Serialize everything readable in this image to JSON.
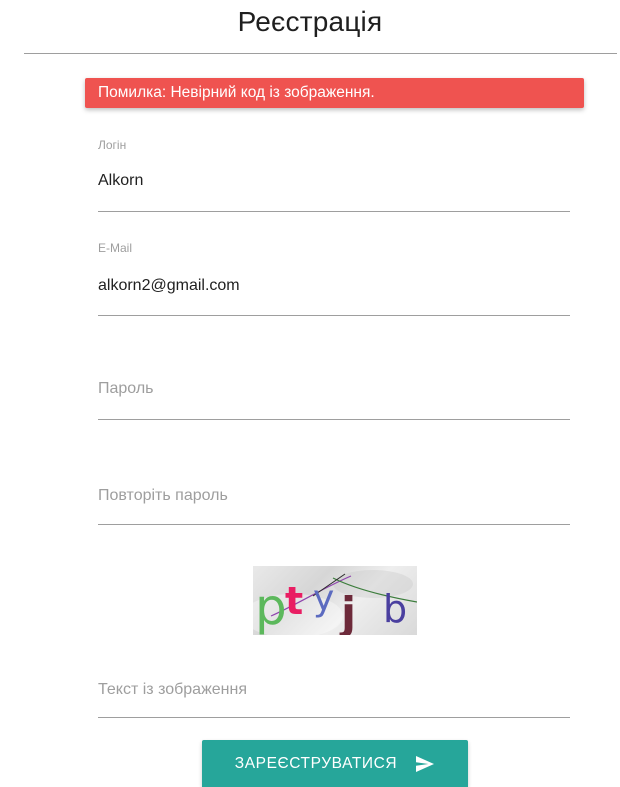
{
  "page": {
    "title": "Реєстрація"
  },
  "alert": {
    "text": "Помилка: Невірний код із зображення.",
    "color": "#ef5350"
  },
  "form": {
    "login": {
      "label": "Логін",
      "value": "Alkorn"
    },
    "email": {
      "label": "E-Mail",
      "value": "alkorn2@gmail.com"
    },
    "password": {
      "placeholder": "Пароль"
    },
    "password_repeat": {
      "placeholder": "Повторіть пароль"
    },
    "captcha": {
      "image_text": "ptyjb",
      "characters": [
        {
          "char": "p",
          "color": "#5cb85c"
        },
        {
          "char": "t",
          "color": "#e91e63"
        },
        {
          "char": "y",
          "color": "#5c6bc0"
        },
        {
          "char": "j",
          "color": "#6d2a3a"
        },
        {
          "char": "b",
          "color": "#4a3f9f"
        }
      ]
    },
    "captcha_text": {
      "placeholder": "Текст із зображення"
    },
    "submit": {
      "label": "ЗАРЕЄСТРУВАТИСЯ",
      "icon": "send-icon",
      "color": "#26a69a"
    }
  }
}
